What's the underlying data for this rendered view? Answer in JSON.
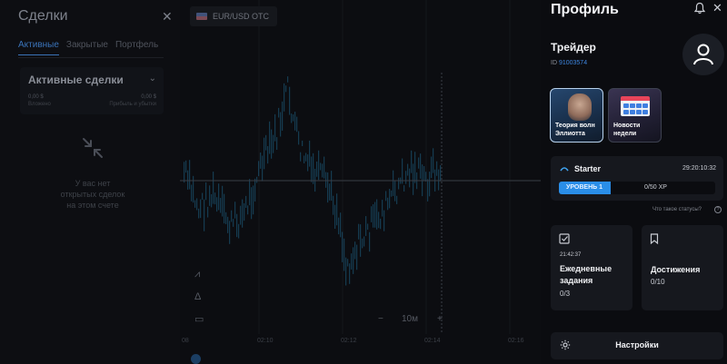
{
  "trades": {
    "title": "Сделки",
    "close": "✕",
    "tabs": [
      "Активные",
      "Закрытые",
      "Портфель"
    ],
    "active_card": {
      "title": "Активные сделки",
      "invested_value": "0,00 $",
      "invested_label": "Вложено",
      "profit_value": "0,00 $",
      "profit_label": "Прибыль и убытки"
    },
    "empty_message": "У вас нет открытых сделок на этом счете"
  },
  "chart": {
    "asset": "EUR/USD OTC",
    "timeframe": "10м",
    "zoom_out": "−",
    "zoom_in": "+",
    "time_labels": [
      "08",
      "02:10",
      "02:12",
      "02:14",
      "02:16"
    ]
  },
  "profile": {
    "title": "Профиль",
    "close": "✕",
    "role": "Трейдер",
    "id_label": "ID",
    "id_value": "91003574",
    "stories": [
      {
        "label": "Теория волн Эллиотта"
      },
      {
        "label": "Новости недели"
      }
    ],
    "status": {
      "name": "Starter",
      "timer": "29:20:10:32",
      "level_label": "УРОВЕНЬ 1",
      "xp": "0/50 XP",
      "progress": 0.33,
      "help_text": "Что такое статусы?"
    },
    "daily": {
      "time": "21:42:37",
      "title": "Ежедневные задания",
      "value": "0/3"
    },
    "achievements": {
      "title": "Достижения",
      "value": "0/10"
    },
    "settings_label": "Настройки"
  },
  "colors": {
    "accent": "#2a8ee8",
    "link": "#3d86e0",
    "candle": "#27a0d8"
  }
}
